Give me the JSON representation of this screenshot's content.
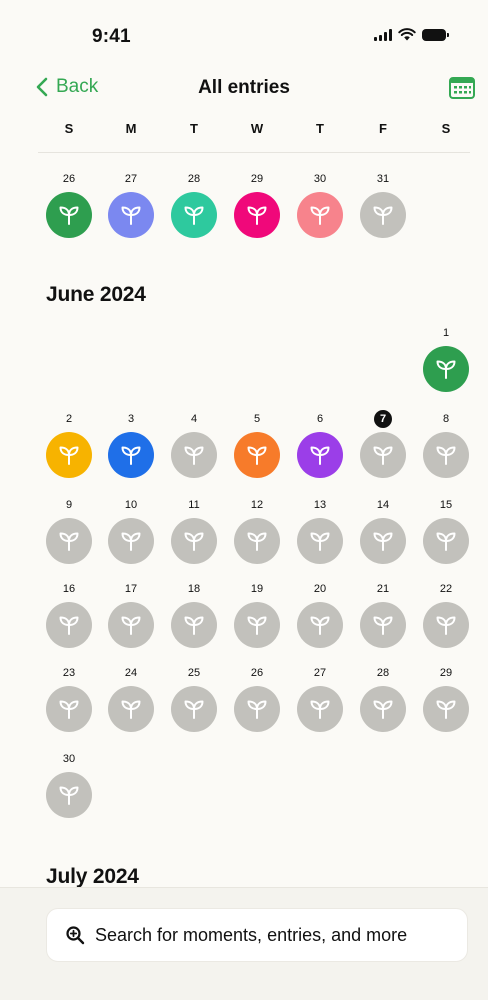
{
  "status_bar": {
    "time": "9:41"
  },
  "nav": {
    "back_label": "Back",
    "title": "All entries",
    "calendar_icon": "calendar-icon"
  },
  "weekdays": [
    "S",
    "M",
    "T",
    "W",
    "T",
    "F",
    "S"
  ],
  "months": [
    {
      "title": "",
      "days": [
        {
          "n": "26",
          "color": "#2e9e4f"
        },
        {
          "n": "27",
          "color": "#7b88f0"
        },
        {
          "n": "28",
          "color": "#2ec99e"
        },
        {
          "n": "29",
          "color": "#f0087a"
        },
        {
          "n": "30",
          "color": "#f7838c"
        },
        {
          "n": "31",
          "color": "#c2c1bc"
        }
      ]
    },
    {
      "title": "June 2024",
      "days": [
        {
          "n": "1",
          "color": "#2e9e4f"
        },
        {
          "n": "2",
          "color": "#f7b300"
        },
        {
          "n": "3",
          "color": "#1f6fe8"
        },
        {
          "n": "4",
          "color": "#c2c1bc"
        },
        {
          "n": "5",
          "color": "#f77b2a"
        },
        {
          "n": "6",
          "color": "#9b3ee8"
        },
        {
          "n": "7",
          "color": "#c2c1bc",
          "today": true
        },
        {
          "n": "8",
          "color": "#c2c1bc"
        },
        {
          "n": "9",
          "color": "#c2c1bc"
        },
        {
          "n": "10",
          "color": "#c2c1bc"
        },
        {
          "n": "11",
          "color": "#c2c1bc"
        },
        {
          "n": "12",
          "color": "#c2c1bc"
        },
        {
          "n": "13",
          "color": "#c2c1bc"
        },
        {
          "n": "14",
          "color": "#c2c1bc"
        },
        {
          "n": "15",
          "color": "#c2c1bc"
        },
        {
          "n": "16",
          "color": "#c2c1bc"
        },
        {
          "n": "17",
          "color": "#c2c1bc"
        },
        {
          "n": "18",
          "color": "#c2c1bc"
        },
        {
          "n": "19",
          "color": "#c2c1bc"
        },
        {
          "n": "20",
          "color": "#c2c1bc"
        },
        {
          "n": "21",
          "color": "#c2c1bc"
        },
        {
          "n": "22",
          "color": "#c2c1bc"
        },
        {
          "n": "23",
          "color": "#c2c1bc"
        },
        {
          "n": "24",
          "color": "#c2c1bc"
        },
        {
          "n": "25",
          "color": "#c2c1bc"
        },
        {
          "n": "26",
          "color": "#c2c1bc"
        },
        {
          "n": "27",
          "color": "#c2c1bc"
        },
        {
          "n": "28",
          "color": "#c2c1bc"
        },
        {
          "n": "29",
          "color": "#c2c1bc"
        },
        {
          "n": "30",
          "color": "#c2c1bc"
        }
      ]
    },
    {
      "title": "July 2024",
      "days": []
    }
  ],
  "entry_icon": "sprout-icon",
  "search": {
    "placeholder": "Search for moments, entries, and more",
    "icon": "search-icon"
  },
  "accent_color": "#34a853"
}
